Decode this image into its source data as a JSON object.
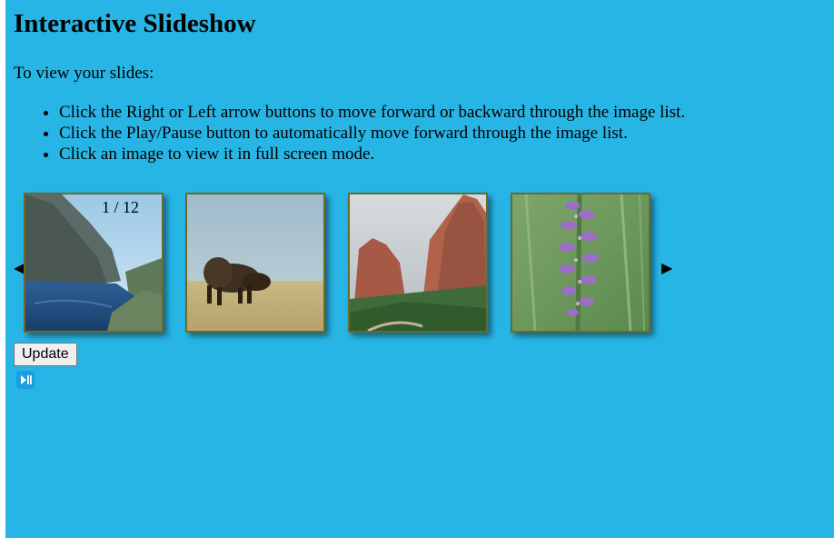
{
  "page": {
    "title": "Interactive Slideshow",
    "intro": "To view your slides:",
    "instructions": [
      "Click the Right or Left arrow buttons to move forward or backward through the image list.",
      "Click the Play/Pause button to automatically move forward through the image list.",
      "Click an image to view it in full screen mode."
    ]
  },
  "slideshow": {
    "counter": "1 / 12",
    "left_arrow_icon": "left-arrow-icon",
    "right_arrow_icon": "right-arrow-icon",
    "thumbnails": [
      {
        "subject": "mountain-lake"
      },
      {
        "subject": "bison-in-grassland"
      },
      {
        "subject": "red-rock-formations"
      },
      {
        "subject": "purple-wildflower"
      }
    ]
  },
  "controls": {
    "update_label": "Update",
    "play_pause_icon": "play-pause-icon"
  },
  "colors": {
    "background": "#27b5e5",
    "thumb_border": "#6b6a2a",
    "play_pause_bg": "#1a9ede"
  }
}
